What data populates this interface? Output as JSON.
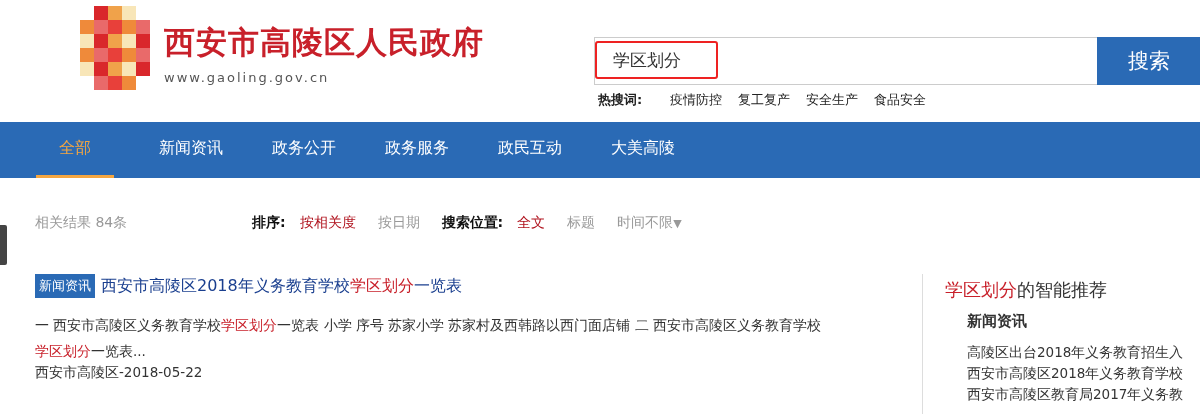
{
  "header": {
    "site_title": "西安市高陵区人民政府",
    "site_url": "www.gaoling.gov.cn"
  },
  "search": {
    "value": "学区划分",
    "button": "搜索",
    "hot_label": "热搜词:",
    "hot_words": [
      "疫情防控",
      "复工复产",
      "安全生产",
      "食品安全"
    ]
  },
  "nav": [
    {
      "label": "全部",
      "selected": true
    },
    {
      "label": "新闻资讯",
      "selected": false
    },
    {
      "label": "政务公开",
      "selected": false
    },
    {
      "label": "政务服务",
      "selected": false
    },
    {
      "label": "政民互动",
      "selected": false
    },
    {
      "label": "大美高陵",
      "selected": false
    }
  ],
  "filters": {
    "count": "相关结果 84条",
    "sort_label": "排序:",
    "sort_options": [
      {
        "label": "按相关度",
        "selected": true
      },
      {
        "label": "按日期",
        "selected": false
      }
    ],
    "scope_label": "搜索位置:",
    "scope_options": [
      {
        "label": "全文",
        "selected": true
      },
      {
        "label": "标题",
        "selected": false
      }
    ],
    "time": "时间不限",
    "time_caret": "▼"
  },
  "results": [
    {
      "tag": "新闻资讯",
      "title": [
        {
          "text": "西安市高陵区2018年义务教育学校",
          "highlight": false
        },
        {
          "text": "学区划分",
          "highlight": true
        },
        {
          "text": "一览表",
          "highlight": false
        }
      ],
      "snippet": [
        {
          "text": "一 西安市高陵区义务教育学校",
          "highlight": false
        },
        {
          "text": "学区划分",
          "highlight": true
        },
        {
          "text": "一览表 小学 序号 苏家小学 苏家村及西韩路以西门面店铺 二 西安市高陵区义务教育学校",
          "highlight": false
        },
        {
          "text": "学区划分",
          "highlight": true
        },
        {
          "text": "一览表...",
          "highlight": false
        }
      ],
      "source": "西安市高陵区-2018-05-22"
    }
  ],
  "sidebar": {
    "title": [
      {
        "text": "学区划分",
        "highlight": true
      },
      {
        "text": "的智能推荐",
        "highlight": false
      }
    ],
    "section": "新闻资讯",
    "items": [
      "高陵区出台2018年义务教育招生入",
      "西安市高陵区2018年义务教育学校",
      "西安市高陵区教育局2017年义务教"
    ]
  }
}
